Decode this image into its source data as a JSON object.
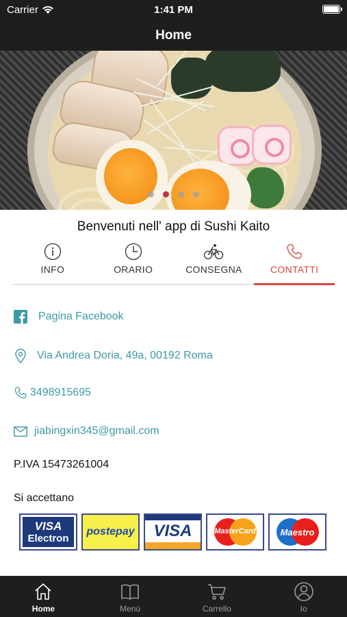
{
  "status_bar": {
    "carrier": "Carrier",
    "time": "1:41 PM"
  },
  "nav": {
    "title": "Home"
  },
  "carousel": {
    "slide_count": 4,
    "active_index": 1
  },
  "welcome": "Benvenuti nell' app di Sushi Kaito",
  "tabs": [
    {
      "label": "INFO",
      "icon": "info-icon",
      "active": false
    },
    {
      "label": "ORARIO",
      "icon": "clock-icon",
      "active": false
    },
    {
      "label": "CONSEGNA",
      "icon": "bicycle-icon",
      "active": false
    },
    {
      "label": "CONTATTI",
      "icon": "phone-icon",
      "active": true
    }
  ],
  "contacts": {
    "facebook": "Pagina Facebook",
    "address": "Via Andrea Doria, 49a, 00192 Roma",
    "phone": "3498915695",
    "email": "jiabingxin345@gmail.com"
  },
  "piva": "P.IVA 15473261004",
  "accept_label": "Si accettano",
  "cards": {
    "visa_electron_top": "VISA",
    "visa_electron_bottom": "Electron",
    "postepay": "postepay",
    "visa": "VISA",
    "mastercard": "MasterCard",
    "maestro": "Maestro"
  },
  "tab_bar": [
    {
      "label": "Home",
      "icon": "home-icon",
      "active": true
    },
    {
      "label": "Menù",
      "icon": "book-icon",
      "active": false
    },
    {
      "label": "Carrello",
      "icon": "cart-icon",
      "active": false
    },
    {
      "label": "Io",
      "icon": "user-icon",
      "active": false
    }
  ],
  "colors": {
    "accent": "#d6453f",
    "link": "#3c9aa6",
    "bar": "#1e1e1e"
  }
}
